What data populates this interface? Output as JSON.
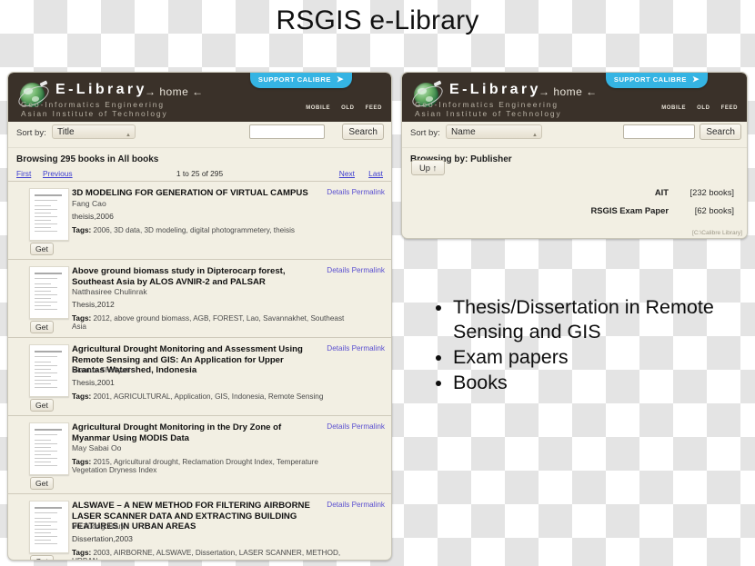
{
  "title": "RSGIS e-Library",
  "header": {
    "brand": "E-Library",
    "home": "→ home ←",
    "sub1": "Geo-Informatics Engineering",
    "sub2": "Asian Institute of Technology",
    "support_label": "SUPPORT CALIBRE",
    "support_arrow": "➤",
    "links": [
      "Mobile",
      "Old",
      "Feed"
    ]
  },
  "left": {
    "sort_label": "Sort by:",
    "sort_value": "Title",
    "search_value": "",
    "search_placeholder": "",
    "search_button": "Search",
    "browsing": "Browsing 295 books in All books",
    "pager": {
      "first": "First",
      "previous": "Previous",
      "middle": "1 to 25 of 295",
      "next": "Next",
      "last": "Last"
    },
    "get_label": "Get",
    "details_label": "Details",
    "permalink_label": "Permalink",
    "tags_label": "Tags:",
    "books": [
      {
        "title": "3D MODELING FOR GENERATION OF VIRTUAL CAMPUS",
        "author": "Fang Cao",
        "series": "theisis,2006",
        "tags": "2006, 3D data, 3D modeling, digital photogrammetery, theisis"
      },
      {
        "title": "Above ground biomass study in Dipterocarp forest, Southeast Asia by ALOS AVNIR-2 and PALSAR",
        "author": "Natthasiree Chulinrak",
        "series": "Thesis,2012",
        "tags": "2012, above ground biomass, AGB, FOREST, Lao, Savannakhet, Southeast Asia"
      },
      {
        "title": "Agricultural Drought Monitoring and Assessment Using Remote Sensing and GIS: An Application for Upper Brantas Watershed, Indonesia",
        "author": "Rizatus Shofiyati",
        "series": "Thesis,2001",
        "tags": "2001, AGRICULTURAL, Application, GIS, Indonesia, Remote Sensing"
      },
      {
        "title": "Agricultural Drought Monitoring in the Dry Zone of Myanmar Using MODIS Data",
        "author": "May Sabai Oo",
        "series": "",
        "tags": "2015, Agricultural drought, Reclamation Drought Index, Temperature Vegetation Dryness Index"
      },
      {
        "title": "ALSWAVE – A NEW METHOD FOR FILTERING AIRBORNE LASER SCANNER DATA AND EXTRACTING BUILDING FEATURES IN URBAN AREAS",
        "author": "Vu Tuong Thuy",
        "series": "Dissertation,2003",
        "tags": "2003, AIRBORNE, ALSWAVE, Dissertation, LASER SCANNER, METHOD, URBAN"
      }
    ]
  },
  "right": {
    "sort_label": "Sort by:",
    "sort_value": "Name",
    "search_value": "",
    "search_button": "Search",
    "browsing": "Browsing by: Publisher",
    "up_label": "Up ↑",
    "publishers": [
      {
        "name": "AIT",
        "count": "[232 books]"
      },
      {
        "name": "RSGIS Exam Paper",
        "count": "[62 books]"
      }
    ],
    "library_path": "[C:\\Calibre Library]"
  },
  "bullets": [
    "Thesis/Dissertation in Remote Sensing and GIS",
    "Exam papers",
    "Books"
  ],
  "colors": {
    "header_bg": "#3a3129",
    "panel_bg": "#f2efe3",
    "accent_blue": "#35b4e3",
    "link": "#3b3bd0"
  }
}
